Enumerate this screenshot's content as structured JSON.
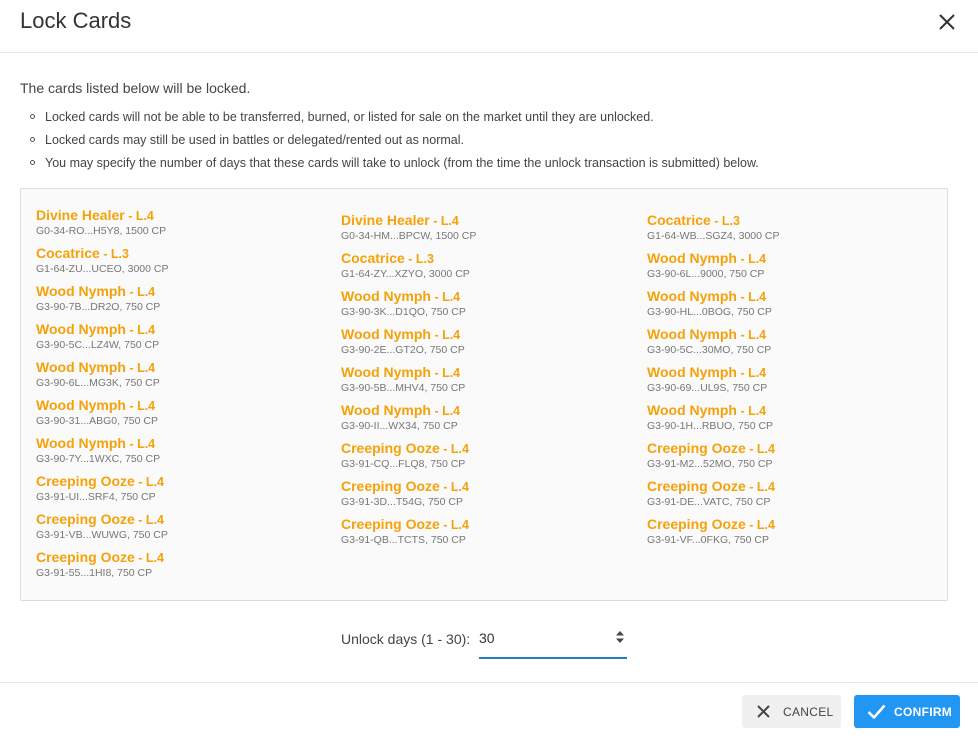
{
  "dialog": {
    "title": "Lock Cards",
    "intro": "The cards listed below will be locked.",
    "notes": [
      "Locked cards will not be able to be transferred, burned, or listed for sale on the market until they are unlocked.",
      "Locked cards may still be used in battles or delegated/rented out as normal.",
      "You may specify the number of days that these cards will take to unlock (from the time the unlock transaction is submitted) below."
    ]
  },
  "cards": {
    "col1": [
      {
        "name": "Divine Healer",
        "level": "L.4",
        "meta": "G0-34-RO...H5Y8, 1500 CP"
      },
      {
        "name": "Cocatrice",
        "level": "L.3",
        "meta": "G1-64-ZU...UCEO, 3000 CP"
      },
      {
        "name": "Wood Nymph",
        "level": "L.4",
        "meta": "G3-90-7B...DR2O, 750 CP"
      },
      {
        "name": "Wood Nymph",
        "level": "L.4",
        "meta": "G3-90-5C...LZ4W, 750 CP"
      },
      {
        "name": "Wood Nymph",
        "level": "L.4",
        "meta": "G3-90-6L...MG3K, 750 CP"
      },
      {
        "name": "Wood Nymph",
        "level": "L.4",
        "meta": "G3-90-31...ABG0, 750 CP"
      },
      {
        "name": "Wood Nymph",
        "level": "L.4",
        "meta": "G3-90-7Y...1WXC, 750 CP"
      },
      {
        "name": "Creeping Ooze",
        "level": "L.4",
        "meta": "G3-91-UI...SRF4, 750 CP"
      },
      {
        "name": "Creeping Ooze",
        "level": "L.4",
        "meta": "G3-91-VB...WUWG, 750 CP"
      },
      {
        "name": "Creeping Ooze",
        "level": "L.4",
        "meta": "G3-91-55...1HI8, 750 CP"
      }
    ],
    "col2": [
      {
        "name": "Divine Healer",
        "level": "L.4",
        "meta": "G0-34-HM...BPCW, 1500 CP"
      },
      {
        "name": "Cocatrice",
        "level": "L.3",
        "meta": "G1-64-ZY...XZYO, 3000 CP"
      },
      {
        "name": "Wood Nymph",
        "level": "L.4",
        "meta": "G3-90-3K...D1QO, 750 CP"
      },
      {
        "name": "Wood Nymph",
        "level": "L.4",
        "meta": "G3-90-2E...GT2O, 750 CP"
      },
      {
        "name": "Wood Nymph",
        "level": "L.4",
        "meta": "G3-90-5B...MHV4, 750 CP"
      },
      {
        "name": "Wood Nymph",
        "level": "L.4",
        "meta": "G3-90-II...WX34, 750 CP"
      },
      {
        "name": "Creeping Ooze",
        "level": "L.4",
        "meta": "G3-91-CQ...FLQ8, 750 CP"
      },
      {
        "name": "Creeping Ooze",
        "level": "L.4",
        "meta": "G3-91-3D...T54G, 750 CP"
      },
      {
        "name": "Creeping Ooze",
        "level": "L.4",
        "meta": "G3-91-QB...TCTS, 750 CP"
      }
    ],
    "col3": [
      {
        "name": "Cocatrice",
        "level": "L.3",
        "meta": "G1-64-WB...SGZ4, 3000 CP"
      },
      {
        "name": "Wood Nymph",
        "level": "L.4",
        "meta": "G3-90-6L...9000, 750 CP"
      },
      {
        "name": "Wood Nymph",
        "level": "L.4",
        "meta": "G3-90-HL...0BOG, 750 CP"
      },
      {
        "name": "Wood Nymph",
        "level": "L.4",
        "meta": "G3-90-5C...30MO, 750 CP"
      },
      {
        "name": "Wood Nymph",
        "level": "L.4",
        "meta": "G3-90-69...UL9S, 750 CP"
      },
      {
        "name": "Wood Nymph",
        "level": "L.4",
        "meta": "G3-90-1H...RBUO, 750 CP"
      },
      {
        "name": "Creeping Ooze",
        "level": "L.4",
        "meta": "G3-91-M2...52MO, 750 CP"
      },
      {
        "name": "Creeping Ooze",
        "level": "L.4",
        "meta": "G3-91-DE...VATC, 750 CP"
      },
      {
        "name": "Creeping Ooze",
        "level": "L.4",
        "meta": "G3-91-VF...0FKG, 750 CP"
      }
    ]
  },
  "unlock": {
    "label": "Unlock days (1 - 30):",
    "value": "30"
  },
  "buttons": {
    "cancel": "CANCEL",
    "confirm": "CONFIRM"
  },
  "colors": {
    "card_name": "#f5a10a",
    "confirm_bg": "#2196f3",
    "input_underline": "#2b7bc0"
  },
  "icons": {
    "close": "close-icon",
    "cancel": "x-icon",
    "confirm": "check-icon",
    "spinner": "spinner-arrows-icon"
  }
}
